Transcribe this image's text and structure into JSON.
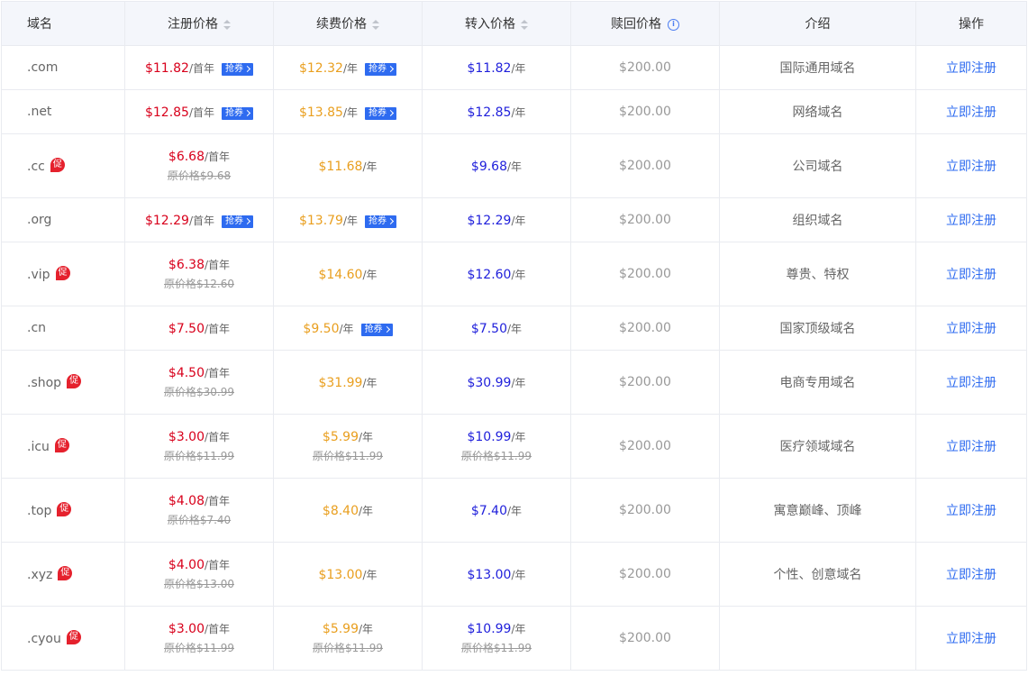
{
  "header": {
    "domain": "域名",
    "register": "注册价格",
    "renew": "续费价格",
    "transfer": "转入价格",
    "redeem": "赎回价格",
    "intro": "介绍",
    "action": "操作"
  },
  "labels": {
    "coupon": "抢券",
    "promo": "促",
    "per_year": "/年",
    "per_first_year": "/首年",
    "register_now": "立即注册"
  },
  "rows": [
    {
      "domain": ".com",
      "promo": false,
      "reg": "$11.82",
      "reg_unit": "/首年",
      "reg_orig": "",
      "reg_coupon": true,
      "renew": "$12.32",
      "renew_orig": "",
      "renew_coupon": true,
      "transfer": "$11.82",
      "transfer_orig": "",
      "redeem": "$200.00",
      "intro": "国际通用域名"
    },
    {
      "domain": ".net",
      "promo": false,
      "reg": "$12.85",
      "reg_unit": "/首年",
      "reg_orig": "",
      "reg_coupon": true,
      "renew": "$13.85",
      "renew_orig": "",
      "renew_coupon": true,
      "transfer": "$12.85",
      "transfer_orig": "",
      "redeem": "$200.00",
      "intro": "网络域名"
    },
    {
      "domain": ".cc",
      "promo": true,
      "reg": "$6.68",
      "reg_unit": "/首年",
      "reg_orig": "原价格$9.68",
      "reg_coupon": false,
      "renew": "$11.68",
      "renew_orig": "",
      "renew_coupon": false,
      "transfer": "$9.68",
      "transfer_orig": "",
      "redeem": "$200.00",
      "intro": "公司域名"
    },
    {
      "domain": ".org",
      "promo": false,
      "reg": "$12.29",
      "reg_unit": "/首年",
      "reg_orig": "",
      "reg_coupon": true,
      "renew": "$13.79",
      "renew_orig": "",
      "renew_coupon": true,
      "transfer": "$12.29",
      "transfer_orig": "",
      "redeem": "$200.00",
      "intro": "组织域名"
    },
    {
      "domain": ".vip",
      "promo": true,
      "reg": "$6.38",
      "reg_unit": "/首年",
      "reg_orig": "原价格$12.60",
      "reg_coupon": false,
      "renew": "$14.60",
      "renew_orig": "",
      "renew_coupon": false,
      "transfer": "$12.60",
      "transfer_orig": "",
      "redeem": "$200.00",
      "intro": "尊贵、特权"
    },
    {
      "domain": ".cn",
      "promo": false,
      "reg": "$7.50",
      "reg_unit": "/首年",
      "reg_orig": "",
      "reg_coupon": false,
      "renew": "$9.50",
      "renew_orig": "",
      "renew_coupon": true,
      "transfer": "$7.50",
      "transfer_orig": "",
      "redeem": "$200.00",
      "intro": "国家顶级域名"
    },
    {
      "domain": ".shop",
      "promo": true,
      "reg": "$4.50",
      "reg_unit": "/首年",
      "reg_orig": "原价格$30.99",
      "reg_coupon": false,
      "renew": "$31.99",
      "renew_orig": "",
      "renew_coupon": false,
      "transfer": "$30.99",
      "transfer_orig": "",
      "redeem": "$200.00",
      "intro": "电商专用域名"
    },
    {
      "domain": ".icu",
      "promo": true,
      "reg": "$3.00",
      "reg_unit": "/首年",
      "reg_orig": "原价格$11.99",
      "reg_coupon": false,
      "renew": "$5.99",
      "renew_orig": "原价格$11.99",
      "renew_coupon": false,
      "transfer": "$10.99",
      "transfer_orig": "原价格$11.99",
      "redeem": "$200.00",
      "intro": "医疗领域域名"
    },
    {
      "domain": ".top",
      "promo": true,
      "reg": "$4.08",
      "reg_unit": "/首年",
      "reg_orig": "原价格$7.40",
      "reg_coupon": false,
      "renew": "$8.40",
      "renew_orig": "",
      "renew_coupon": false,
      "transfer": "$7.40",
      "transfer_orig": "",
      "redeem": "$200.00",
      "intro": "寓意巅峰、顶峰"
    },
    {
      "domain": ".xyz",
      "promo": true,
      "reg": "$4.00",
      "reg_unit": "/首年",
      "reg_orig": "原价格$13.00",
      "reg_coupon": false,
      "renew": "$13.00",
      "renew_orig": "",
      "renew_coupon": false,
      "transfer": "$13.00",
      "transfer_orig": "",
      "redeem": "$200.00",
      "intro": "个性、创意域名"
    },
    {
      "domain": ".cyou",
      "promo": true,
      "reg": "$3.00",
      "reg_unit": "/首年",
      "reg_orig": "原价格$11.99",
      "reg_coupon": false,
      "renew": "$5.99",
      "renew_orig": "原价格$11.99",
      "renew_coupon": false,
      "transfer": "$10.99",
      "transfer_orig": "原价格$11.99",
      "redeem": "$200.00",
      "intro": ""
    }
  ]
}
